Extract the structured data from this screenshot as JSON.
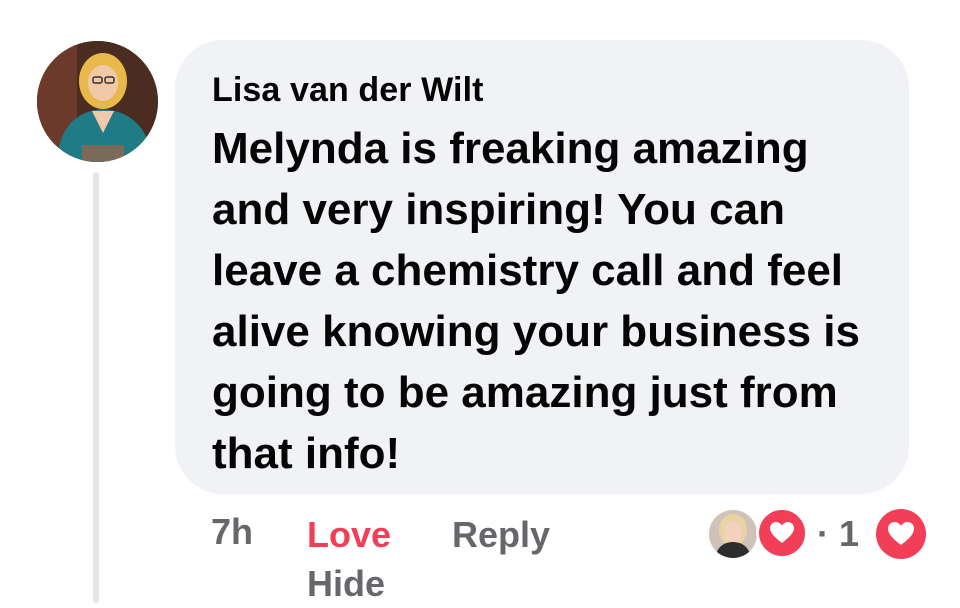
{
  "comment": {
    "author": "Lisa van der Wilt",
    "text": "Melynda is freaking amazing and very inspiring! You can leave a chemistry call and feel alive knowing your business is going to be amazing just from that info!"
  },
  "actions": {
    "timestamp": "7h",
    "love_label": "Love",
    "reply_label": "Reply",
    "hide_label": "Hide"
  },
  "reactions": {
    "separator_count": "· 1",
    "reaction_type": "heart-icon"
  },
  "colors": {
    "bubble_bg": "#f0f2f5",
    "text": "#050505",
    "secondary_text": "#65676b",
    "love_red": "#f33e58",
    "thread_line": "#e4e6eb"
  }
}
